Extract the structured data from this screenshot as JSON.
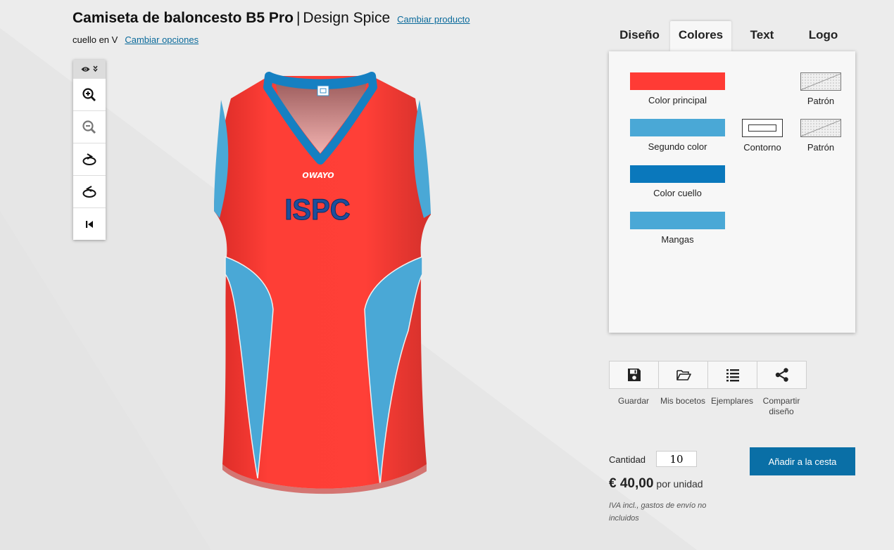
{
  "header": {
    "product_title": "Camiseta de baloncesto B5 Pro",
    "separator": "|",
    "design_name": "Design Spice",
    "change_product": "Cambiar producto",
    "option": "cuello en V",
    "change_options": "Cambiar opciones"
  },
  "jersey": {
    "brand": "OWAYO",
    "text": "ISPC"
  },
  "tabs": [
    {
      "label": "Diseño",
      "active": false
    },
    {
      "label": "Colores",
      "active": true
    },
    {
      "label": "Text",
      "active": false
    },
    {
      "label": "Logo",
      "active": false
    }
  ],
  "colors_panel": {
    "color_principal": {
      "label": "Color principal",
      "color": "#ff3b35"
    },
    "segundo_color": {
      "label": "Segundo color",
      "color": "#4aa8d6"
    },
    "color_cuello": {
      "label": "Color cuello",
      "color": "#0a78bc"
    },
    "mangas": {
      "label": "Mangas",
      "color": "#4aa8d6"
    },
    "contorno": {
      "label": "Contorno"
    },
    "patron_1": {
      "label": "Patrón"
    },
    "patron_2": {
      "label": "Patrón"
    }
  },
  "actions": [
    {
      "label": "Guardar",
      "icon": "save-icon"
    },
    {
      "label": "Mis bocetos",
      "icon": "folder-icon"
    },
    {
      "label": "Ejemplares",
      "icon": "list-icon"
    },
    {
      "label": "Compartir diseño",
      "icon": "share-icon"
    }
  ],
  "purchase": {
    "quantity_label": "Cantidad",
    "quantity": "10",
    "add_to_cart": "Añadir a la cesta",
    "price": "€ 40,00",
    "price_unit": "por unidad",
    "vat_note": "IVA incl., gastos de envío no incluidos"
  }
}
